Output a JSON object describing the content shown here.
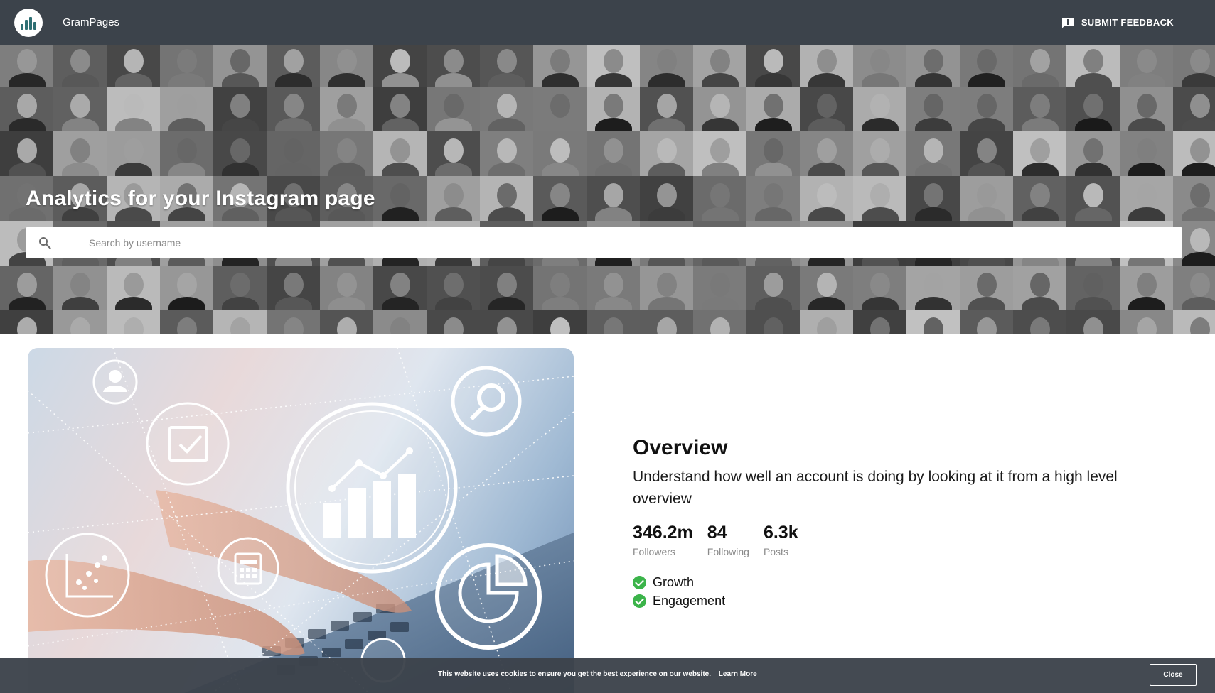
{
  "header": {
    "brand": "GramPages",
    "logo_icon": "bar-chart-logo",
    "feedback_label": "SUBMIT FEEDBACK",
    "feedback_icon": "feedback-icon",
    "background": "#3c434b"
  },
  "hero": {
    "title": "Analytics for your Instagram page",
    "background_image": "grayscale portrait collage",
    "search": {
      "placeholder": "Search by username",
      "value": "",
      "icon": "search-icon"
    }
  },
  "overview": {
    "illustration": "hands typing on laptop with analytics icons",
    "title": "Overview",
    "subtitle": "Understand how well an account is doing by looking at it from a high level overview",
    "stats": [
      {
        "value": "346.2m",
        "label": "Followers"
      },
      {
        "value": "84",
        "label": "Following"
      },
      {
        "value": "6.3k",
        "label": "Posts"
      }
    ],
    "features": [
      {
        "label": "Growth",
        "icon": "check-circle-icon"
      },
      {
        "label": "Engagement",
        "icon": "check-circle-icon"
      }
    ],
    "accent_color": "#3bb44a"
  },
  "cookie_bar": {
    "text": "This website uses cookies to ensure you get the best experience on our website.",
    "link_label": "Learn More",
    "close_label": "Close"
  }
}
